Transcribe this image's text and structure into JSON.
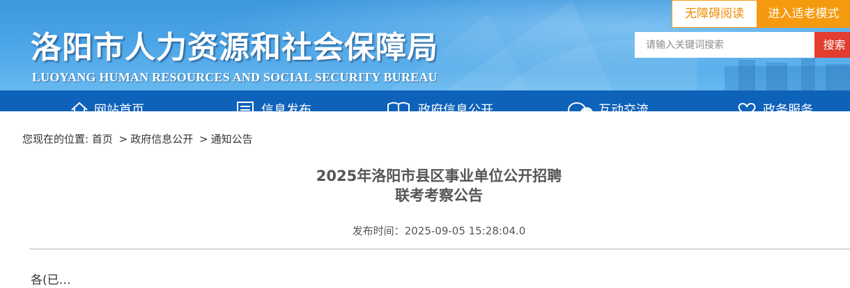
{
  "header": {
    "site_title": "洛阳市人力资源和社会保障局",
    "site_subtitle": "LUOYANG HUMAN RESOURCES AND SOCIAL SECURITY BUREAU",
    "accessible_reading_label": "无障碍阅读",
    "elder_mode_label": "进入适老模式",
    "search": {
      "placeholder": "请输入关键词搜索",
      "value": "",
      "button_label": "搜索"
    }
  },
  "nav": {
    "items": [
      {
        "label": "网站首页",
        "icon": "home-icon"
      },
      {
        "label": "信息发布",
        "icon": "document-icon"
      },
      {
        "label": "政府信息公开",
        "icon": "book-icon"
      },
      {
        "label": "互动交流",
        "icon": "chat-icon"
      },
      {
        "label": "政务服务",
        "icon": "heart-icon"
      }
    ]
  },
  "breadcrumb": {
    "prefix": "您现在的位置:",
    "items": [
      "首页",
      "政府信息公开",
      "通知公告"
    ],
    "separator": ">"
  },
  "article": {
    "title_line1": "2025年洛阳市县区事业单位公开招聘",
    "title_line2": "联考考察公告",
    "publish_label": "发布时间：",
    "publish_time": "2025-09-05 15:28:04.0",
    "body_start": "各(已…"
  },
  "colors": {
    "banner_blue": "#4aa4e6",
    "nav_blue": "#0f62ba",
    "accent_orange": "#f59a0e",
    "search_red": "#e23d2f"
  }
}
